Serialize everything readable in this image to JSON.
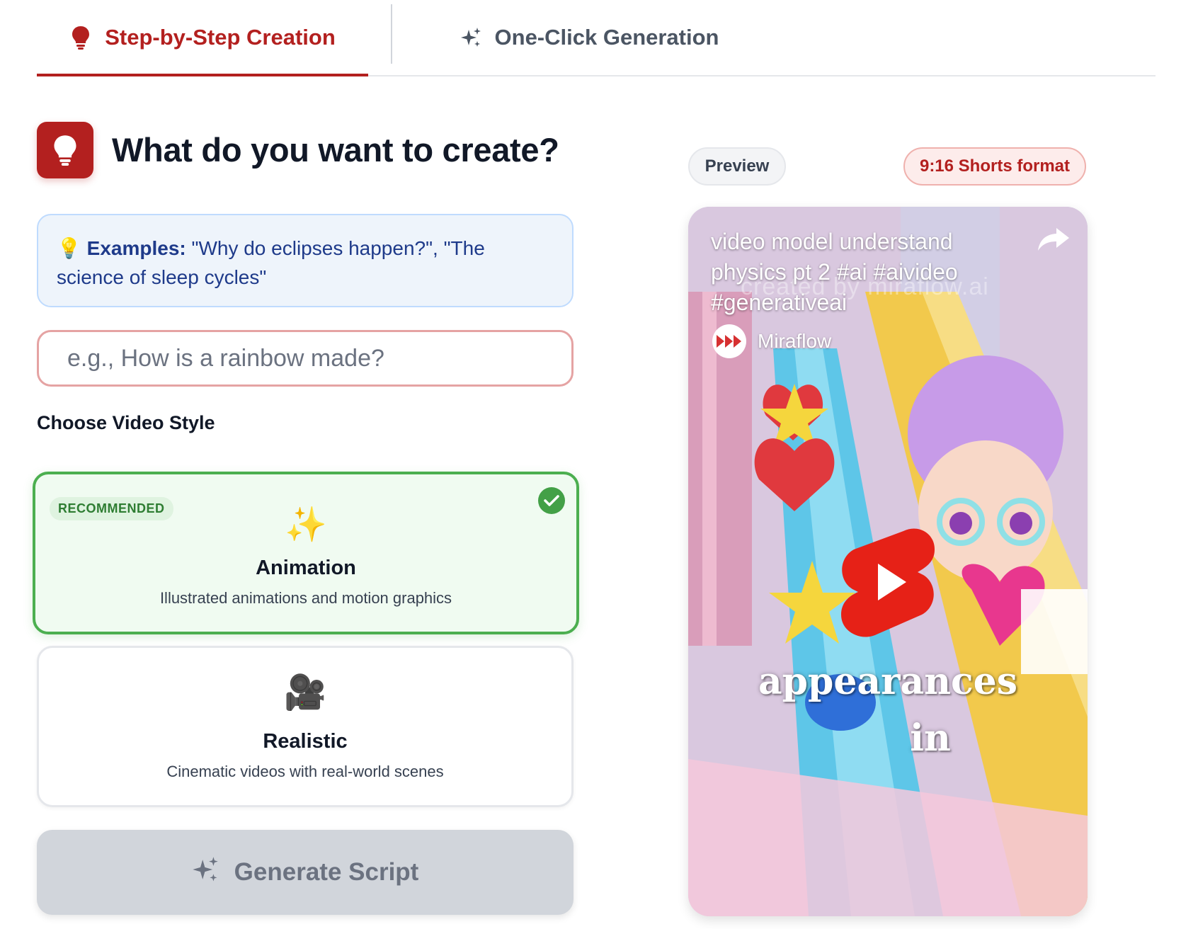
{
  "tabs": [
    {
      "label": "Step-by-Step Creation",
      "icon": "lightbulb-icon",
      "active": true
    },
    {
      "label": "One-Click Generation",
      "icon": "sparkles-icon",
      "active": false
    }
  ],
  "header": {
    "title": "What do you want to create?",
    "icon": "lightbulb-icon"
  },
  "examples": {
    "emoji": "💡",
    "label": "Examples:",
    "text": " \"Why do eclipses happen?\", \"The science of sleep cycles\""
  },
  "topic_input": {
    "placeholder": "e.g., How is a rainbow made?",
    "value": ""
  },
  "style_section": {
    "label": "Choose Video Style",
    "options": [
      {
        "badge": "RECOMMENDED",
        "emoji": "✨",
        "title": "Animation",
        "description": "Illustrated animations and motion graphics",
        "selected": true
      },
      {
        "emoji": "🎥",
        "title": "Realistic",
        "description": "Cinematic videos with real-world scenes",
        "selected": false
      }
    ]
  },
  "generate_button": {
    "label": "Generate Script",
    "icon": "sparkles-icon",
    "disabled": true
  },
  "preview": {
    "label": "Preview",
    "format_label": "9:16 Shorts format",
    "video": {
      "title": "video model understand physics pt 2 #ai #aivideo #generativeai",
      "channel": "Miraflow",
      "watermark": "created by miraflow.ai",
      "caption_line1": "appearances",
      "caption_line2": "in"
    }
  },
  "colors": {
    "brand": "#b3201f",
    "selected_border": "#4caf50",
    "youtube_red": "#e62117"
  }
}
